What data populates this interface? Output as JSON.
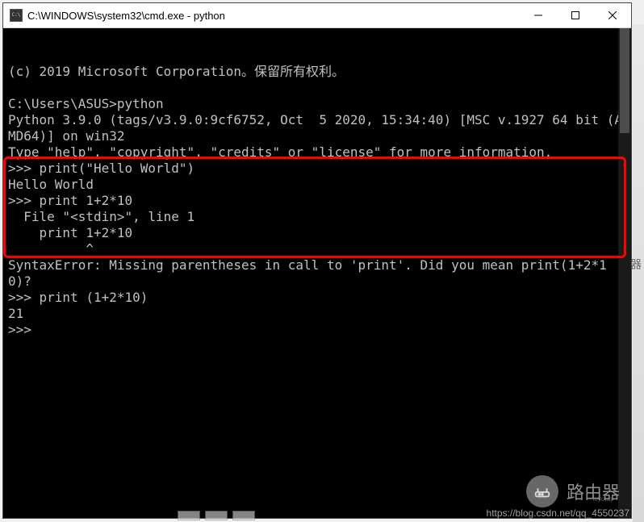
{
  "window": {
    "title": "C:\\WINDOWS\\system32\\cmd.exe - python"
  },
  "terminal": {
    "lines": [
      "(c) 2019 Microsoft Corporation。保留所有权利。",
      "",
      "C:\\Users\\ASUS>python",
      "Python 3.9.0 (tags/v3.9.0:9cf6752, Oct  5 2020, 15:34:40) [MSC v.1927 64 bit (AMD64)] on win32",
      "Type \"help\", \"copyright\", \"credits\" or \"license\" for more information.",
      ">>> print(\"Hello World\")",
      "Hello World",
      ">>> print 1+2*10",
      "  File \"<stdin>\", line 1",
      "    print 1+2*10",
      "          ^",
      "SyntaxError: Missing parentheses in call to 'print'. Did you mean print(1+2*10)?",
      ">>> print (1+2*10)",
      "21",
      ">>> "
    ]
  },
  "watermark": {
    "badge_text": "路由器",
    "small_text": "luyouqi",
    "url": "https://blog.csdn.net/qq_4550237"
  },
  "side_char_text": "器"
}
